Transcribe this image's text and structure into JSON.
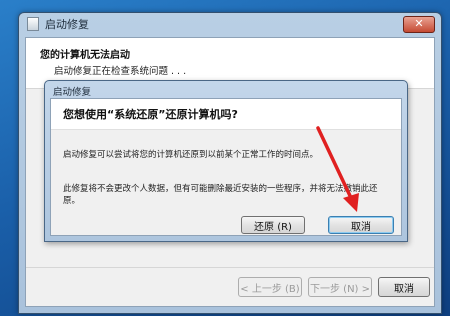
{
  "outer_window": {
    "title": "启动修复",
    "close_glyph": "✕",
    "header_title": "您的计算机无法启动",
    "status_text": "启动修复正在检查系统问题 . . ."
  },
  "footer": {
    "back_label": "< 上一步 (B)",
    "next_label": "下一步 (N) >",
    "cancel_label": "取消"
  },
  "dialog": {
    "title": "启动修复",
    "question": "您想使用“系统还原”还原计算机吗?",
    "text1": "启动修复可以尝试将您的计算机还原到以前某个正常工作的时间点。",
    "text2": "此修复将不会更改个人数据，但有可能删除最近安装的一些程序，并将无法撤销此还原。",
    "restore_label": "还原 (R)",
    "cancel_label": "取消"
  },
  "colors": {
    "annotation_arrow": "#e02020",
    "desktop": "#1a5fa9"
  }
}
